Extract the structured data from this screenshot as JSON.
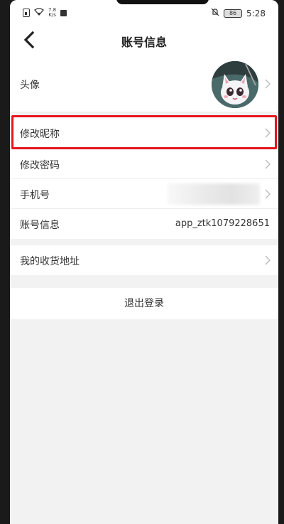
{
  "status_bar": {
    "speed_value": "7.8",
    "speed_unit": "K/s",
    "battery": "86",
    "time": "5:28"
  },
  "header": {
    "title": "账号信息"
  },
  "rows": {
    "avatar_label": "头像",
    "nickname_label": "修改昵称",
    "password_label": "修改密码",
    "phone_label": "手机号",
    "account_label": "账号信息",
    "account_value": "app_ztk1079228651",
    "address_label": "我的收货地址"
  },
  "logout_label": "退出登录",
  "colors": {
    "highlight": "#e8141c",
    "background": "#f2f2f2"
  }
}
